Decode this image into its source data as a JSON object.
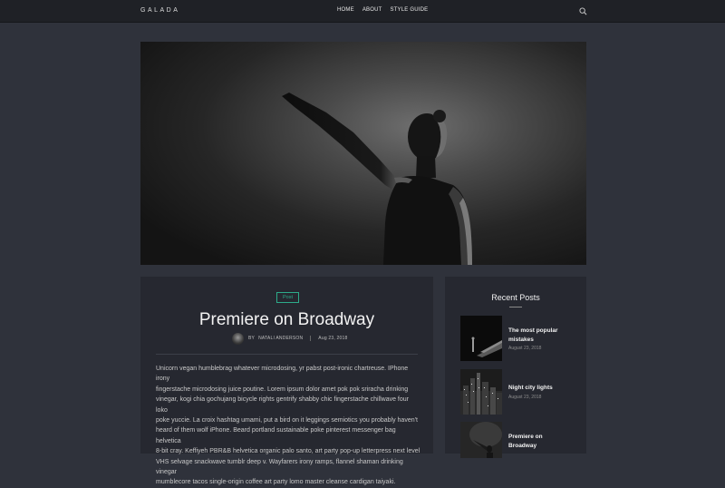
{
  "header": {
    "brand": "GALADA",
    "nav": [
      "HOME",
      "ABOUT",
      "STYLE GUIDE"
    ]
  },
  "post": {
    "tag": "Post",
    "title": "Premiere on Broadway",
    "by_label": "BY",
    "author": "NATALI ANDERSON",
    "date": "Aug 23, 2018",
    "body_lines": [
      "Unicorn vegan humblebrag whatever microdosing, yr pabst post-ironic chartreuse. IPhone irony",
      "fingerstache microdosing juice poutine. Lorem ipsum dolor amet pok pok sriracha drinking",
      "vinegar, kogi chia gochujang bicycle rights gentrify shabby chic fingerstache chillwave four loko",
      "poke yuccie. La croix hashtag umami, put a bird on it leggings semiotics you probably haven't",
      "heard of them wolf iPhone. Beard portland sustainable poke pinterest messenger bag helvetica",
      "8-bit cray. Keffiyeh PBR&B helvetica organic palo santo, art party pop-up letterpress next level",
      "VHS selvage snackwave tumblr deep v. Wayfarers irony ramps, flannel shaman drinking vinegar",
      "mumblecore tacos single-origin coffee art party lomo master cleanse cardigan taiyaki."
    ]
  },
  "sidebar": {
    "title": "Recent Posts",
    "posts": [
      {
        "title": "The most popular mistakes",
        "date": "August 23, 2018"
      },
      {
        "title": "Night city lights",
        "date": "August 23, 2018"
      },
      {
        "title": "Premiere on Broadway",
        "date": ""
      }
    ]
  },
  "colors": {
    "page_bg": "#2f323b",
    "panel_bg": "#262830",
    "topbar_bg": "#1f2126",
    "accent": "#2dab8a"
  }
}
